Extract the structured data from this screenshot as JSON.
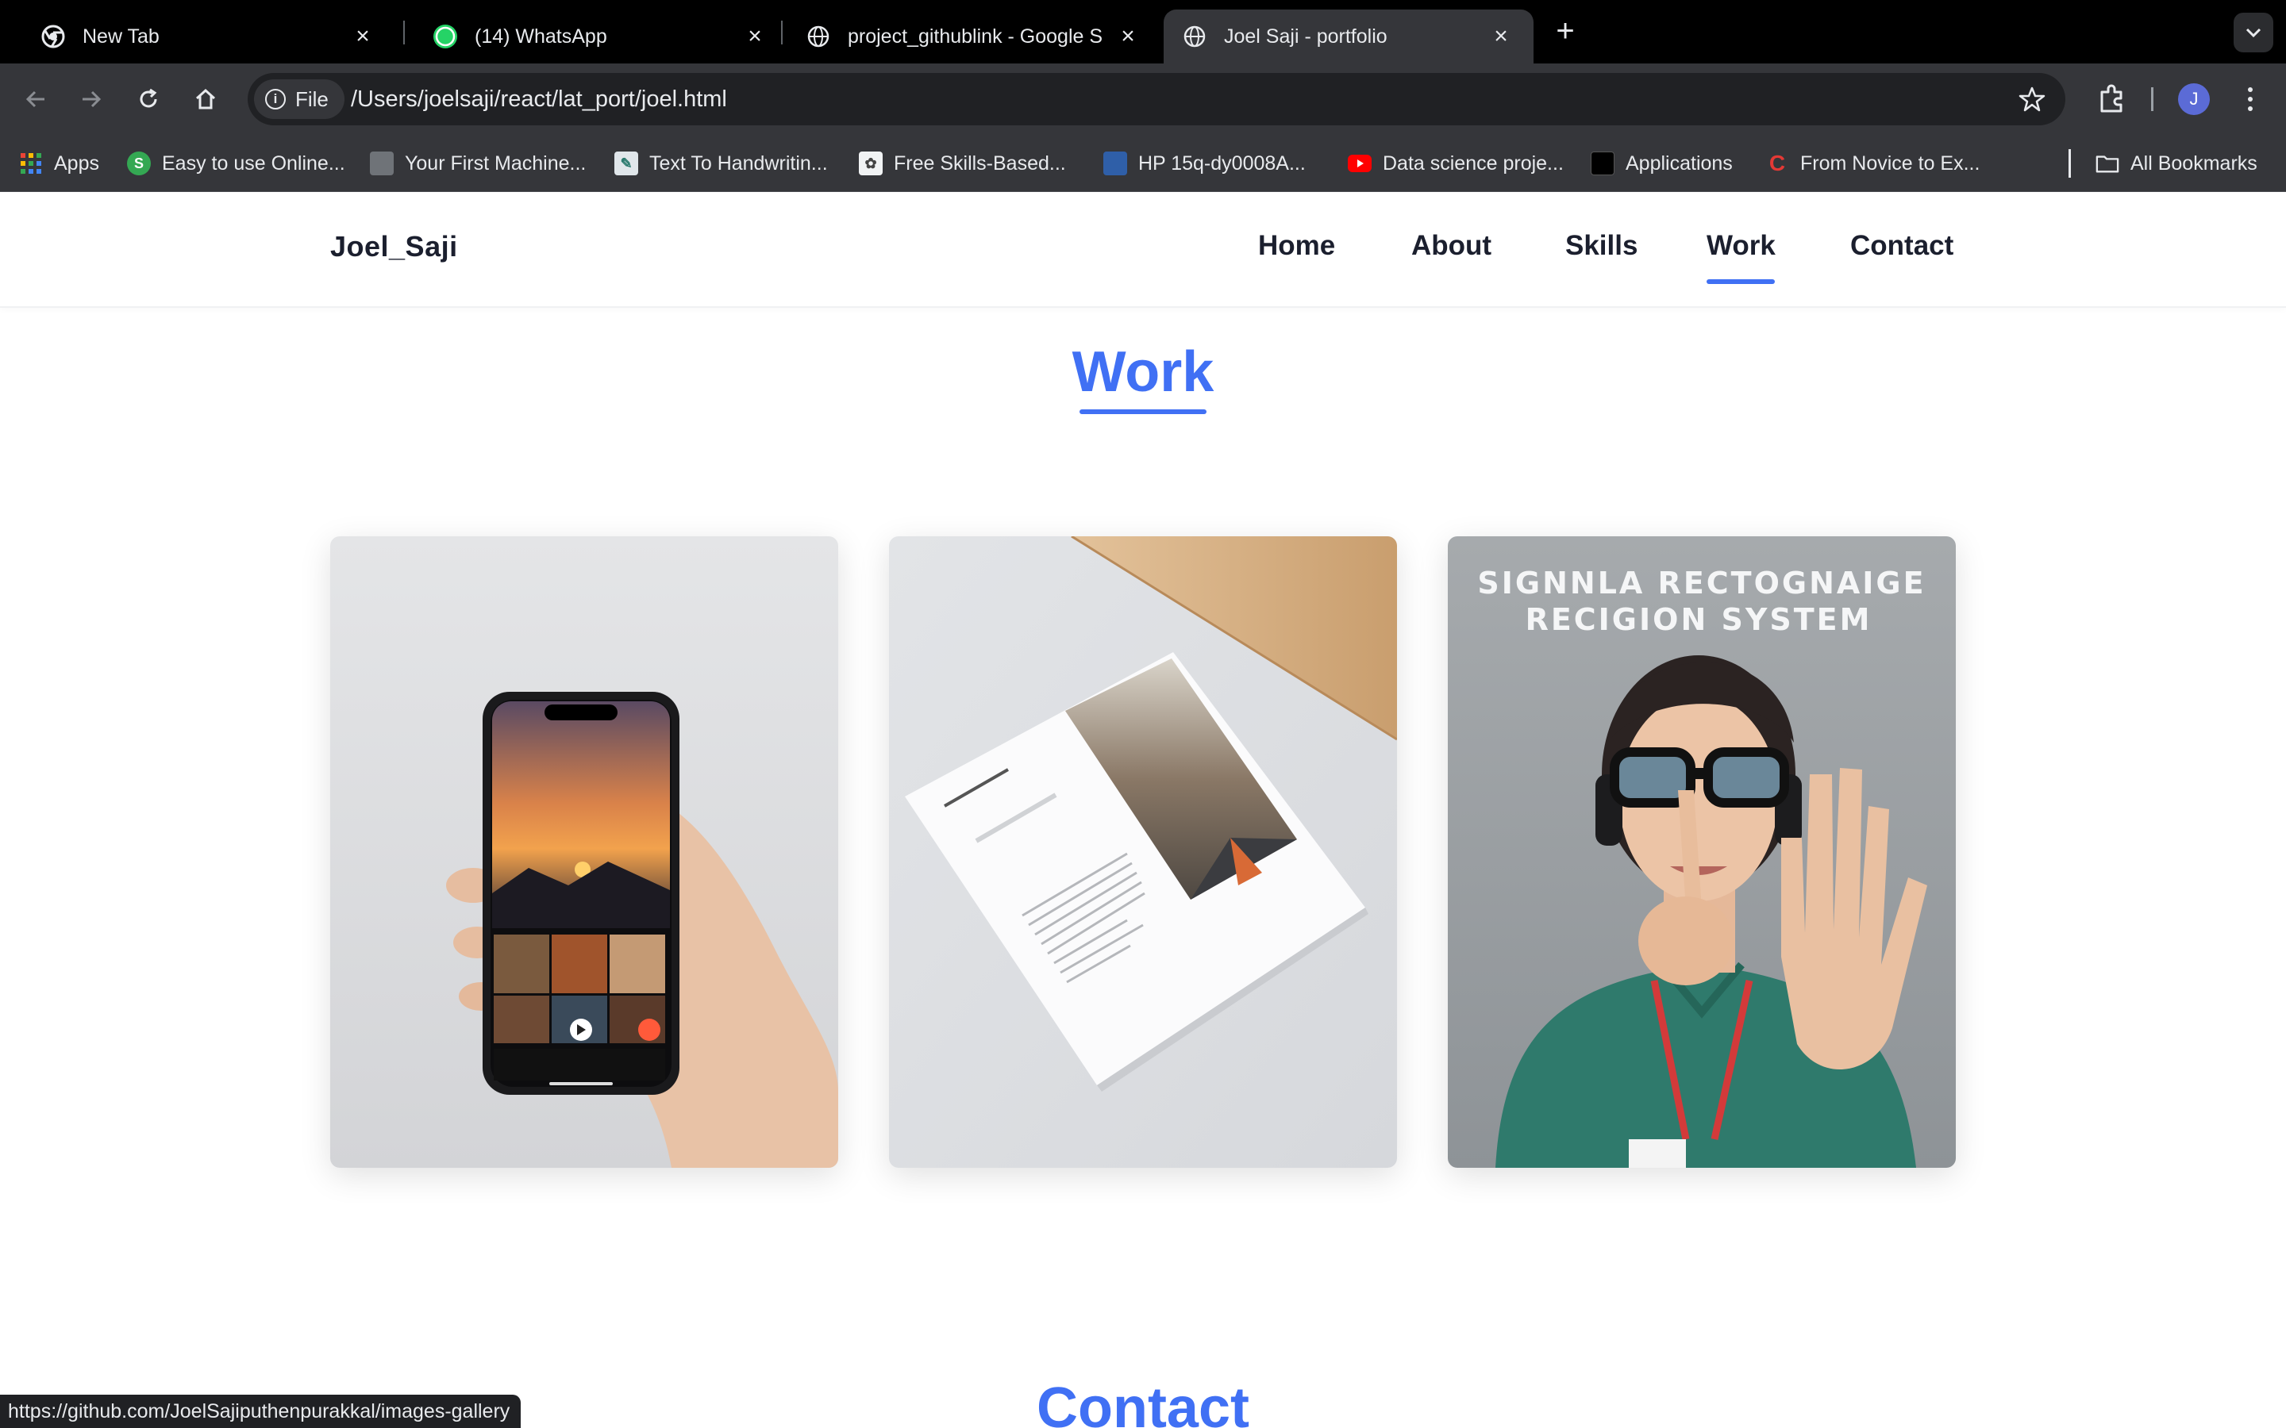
{
  "browser": {
    "tabs": [
      {
        "title": "New Tab",
        "icon": "chrome-icon"
      },
      {
        "title": "(14) WhatsApp",
        "icon": "whatsapp-icon",
        "badge": "14"
      },
      {
        "title": "project_githublink - Google S",
        "icon": "globe-icon"
      },
      {
        "title": "Joel Saji - portfolio",
        "icon": "globe-icon",
        "active": true
      }
    ],
    "site_chip_label": "File",
    "url": "/Users/joelsaji/react/lat_port/joel.html",
    "avatar_initial": "J",
    "bookmarks": [
      {
        "label": "Apps",
        "icon": "apps-grid-icon"
      },
      {
        "label": "Easy to use Online...",
        "icon": "s-logo-icon"
      },
      {
        "label": "Your First Machine...",
        "icon": "thumbnail-icon"
      },
      {
        "label": "Text To Handwritin...",
        "icon": "handwriting-icon"
      },
      {
        "label": "Free Skills-Based...",
        "icon": "skills-icon"
      },
      {
        "label": "HP 15q-dy0008A...",
        "icon": "laptop-icon"
      },
      {
        "label": "Data science proje...",
        "icon": "youtube-icon"
      },
      {
        "label": "Applications",
        "icon": "applications-icon"
      },
      {
        "label": "From Novice to Ex...",
        "icon": "c-logo-icon"
      }
    ],
    "all_bookmarks_label": "All Bookmarks",
    "status_url": "https://github.com/JoelSajiputhenpurakkal/images-gallery"
  },
  "site": {
    "logo": "Joel_Saji",
    "nav": [
      "Home",
      "About",
      "Skills",
      "Work",
      "Contact"
    ],
    "active_nav": "Work",
    "work_title": "Work",
    "next_section_title": "Contact",
    "projects": [
      {
        "image": "phone-image-gallery-photo"
      },
      {
        "image": "portfolio-brochure-photo"
      },
      {
        "image": "sign-language-recognition-photo",
        "overlay_text_line1": "SIGNNLA RECTOGNAIGE",
        "overlay_text_line2": "RECIGION SYSTEM"
      }
    ]
  },
  "colors": {
    "accent": "#4070f4",
    "heading_dark": "#1b1f2e",
    "browser_dark": "#35363a"
  }
}
